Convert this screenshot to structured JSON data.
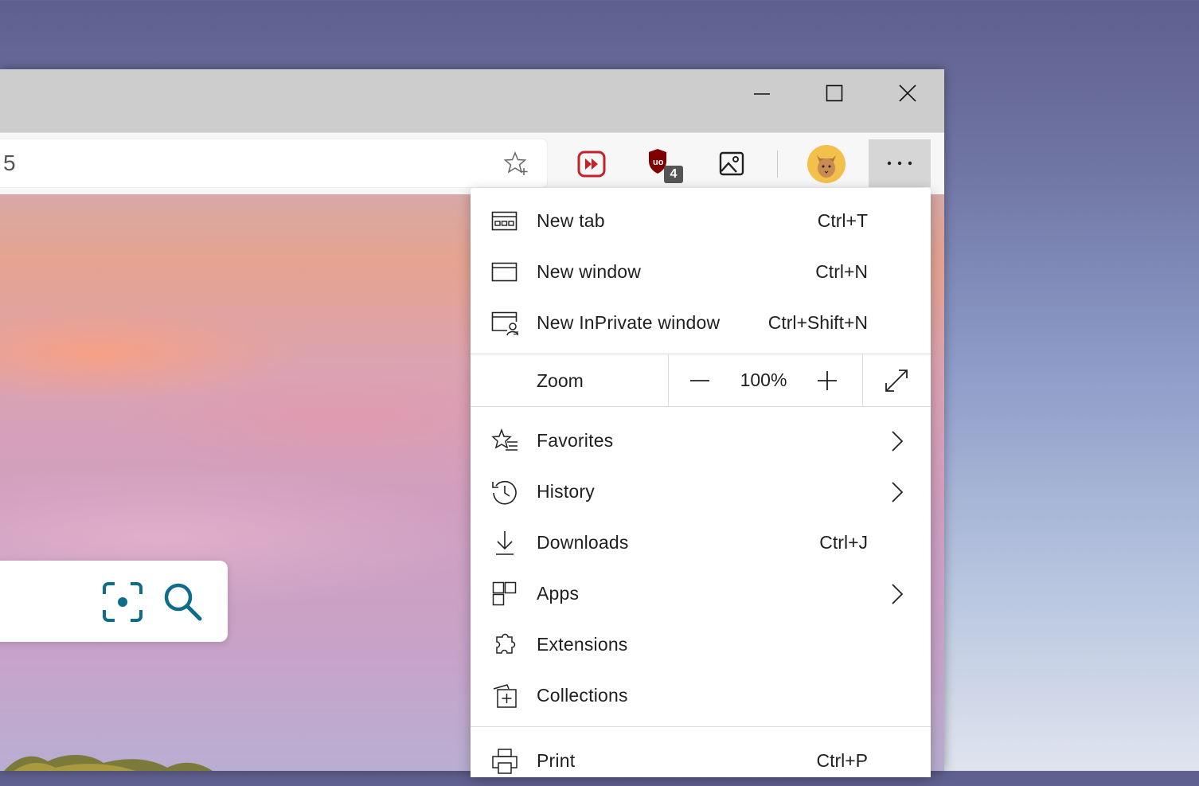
{
  "window": {
    "controls": {
      "minimize": "minimize",
      "maximize": "maximize",
      "close": "close"
    }
  },
  "address_bar": {
    "text": "5"
  },
  "toolbar": {
    "ublock_badge": "4"
  },
  "menu": {
    "items_top": [
      {
        "label": "New tab",
        "shortcut": "Ctrl+T",
        "icon": "new-tab-icon"
      },
      {
        "label": "New window",
        "shortcut": "Ctrl+N",
        "icon": "new-window-icon"
      },
      {
        "label": "New InPrivate window",
        "shortcut": "Ctrl+Shift+N",
        "icon": "inprivate-window-icon"
      }
    ],
    "zoom": {
      "label": "Zoom",
      "value": "100%"
    },
    "items_mid": [
      {
        "label": "Favorites",
        "shortcut": "",
        "icon": "favorites-icon",
        "submenu": true
      },
      {
        "label": "History",
        "shortcut": "",
        "icon": "history-icon",
        "submenu": true
      },
      {
        "label": "Downloads",
        "shortcut": "Ctrl+J",
        "icon": "downloads-icon"
      },
      {
        "label": "Apps",
        "shortcut": "",
        "icon": "apps-icon",
        "submenu": true
      },
      {
        "label": "Extensions",
        "shortcut": "",
        "icon": "extensions-icon"
      },
      {
        "label": "Collections",
        "shortcut": "",
        "icon": "collections-icon"
      }
    ],
    "items_bottom": [
      {
        "label": "Print",
        "shortcut": "Ctrl+P",
        "icon": "print-icon"
      }
    ]
  },
  "colors": {
    "accent": "#0f6d8c",
    "ublock": "#800000",
    "media": "#c4212b"
  }
}
